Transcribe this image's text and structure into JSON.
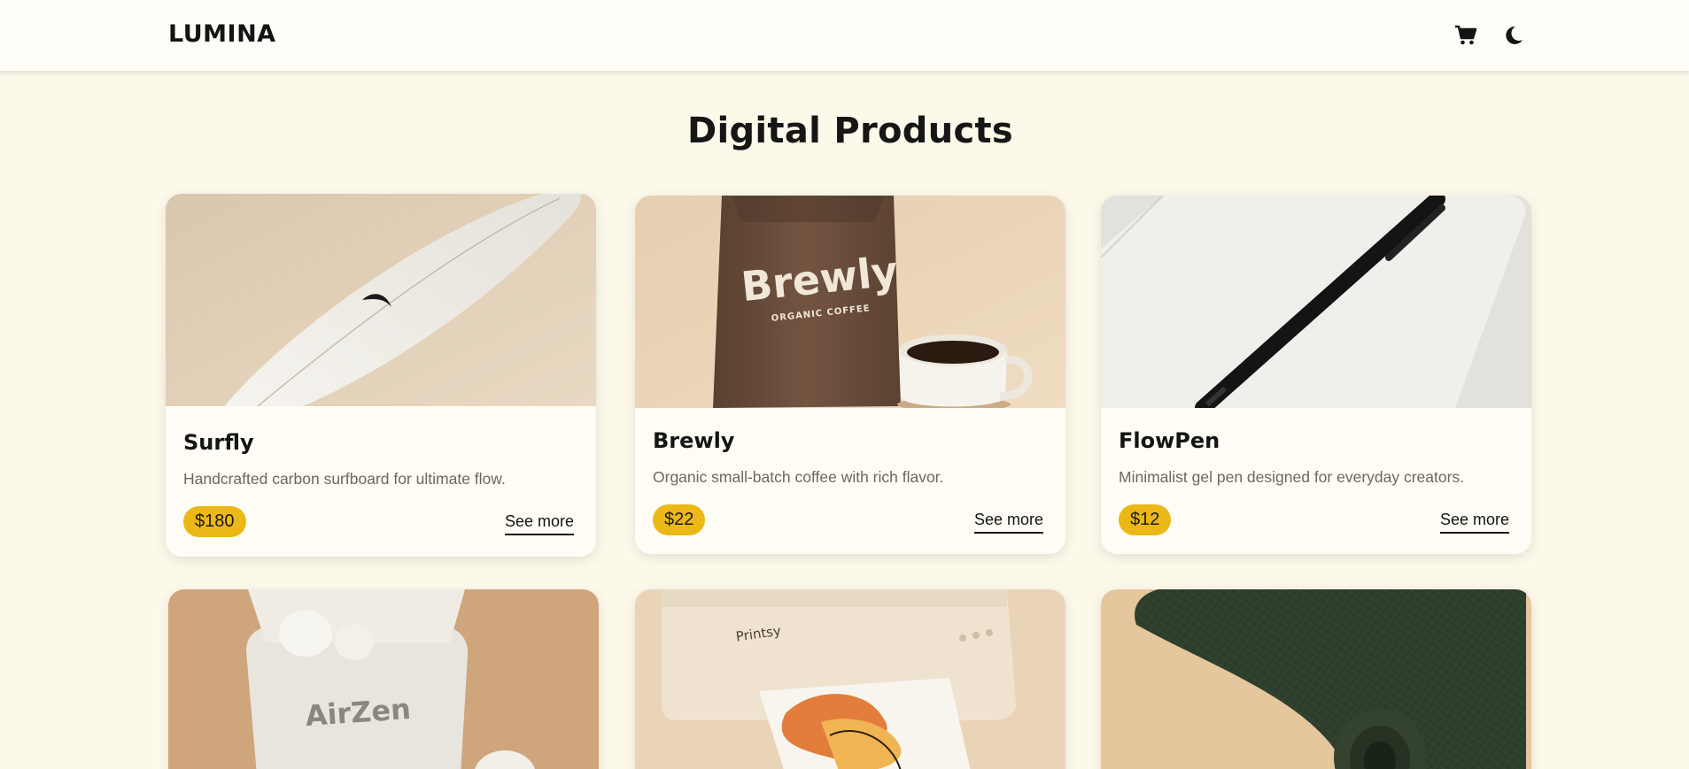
{
  "brand": {
    "name": "LUMINA"
  },
  "header": {
    "icons": [
      "cart-icon",
      "moon-icon"
    ]
  },
  "page": {
    "title": "Digital Products"
  },
  "products": [
    {
      "name": "Surfly",
      "description": "Handcrafted carbon surfboard for ultimate flow.",
      "price": "$180",
      "cta": "See more",
      "image": "surfboard-image"
    },
    {
      "name": "Brewly",
      "description": "Organic small-batch coffee with rich flavor.",
      "price": "$22",
      "cta": "See more",
      "image": "coffee-bag-image",
      "image_text": {
        "brand": "Brewly",
        "sub": "ORGANIC COFFEE"
      }
    },
    {
      "name": "FlowPen",
      "description": "Minimalist gel pen designed for everyday creators.",
      "price": "$12",
      "cta": "See more",
      "image": "pen-image"
    },
    {
      "image": "earbuds-image",
      "image_text": {
        "brand": "AirZen"
      }
    },
    {
      "image": "printer-image",
      "image_text": {
        "brand": "Printsy"
      }
    },
    {
      "image": "yoga-mat-image"
    }
  ],
  "colors": {
    "background": "#fcf8ea",
    "card": "#fffdf5",
    "price_badge": "#ebb817",
    "text": "#141414",
    "muted": "#6a6760"
  }
}
